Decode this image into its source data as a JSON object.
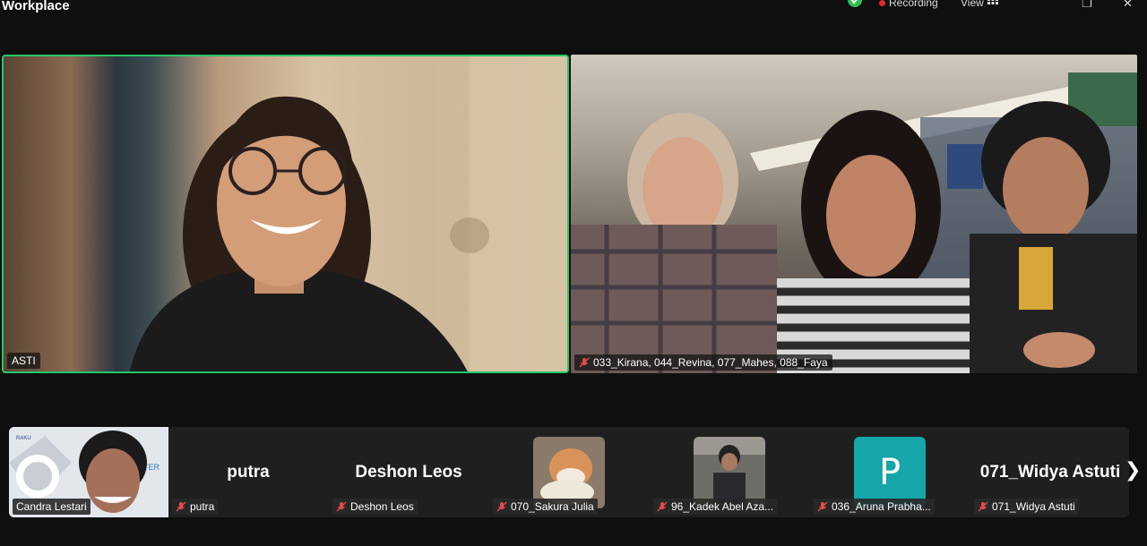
{
  "app": {
    "title": "Workplace"
  },
  "topbar": {
    "recording_label": "Recording",
    "view_label": "View",
    "colors": {
      "shield": "#2fbf4f",
      "recording": "#e02828"
    }
  },
  "speaker": {
    "name": "ASTI",
    "border_color": "#22c76a"
  },
  "group_tile": {
    "name": "033_Kirana, 044_Revina, 077_Mahes, 088_Faya",
    "muted": true
  },
  "filmstrip": {
    "participants": [
      {
        "name": "Candra Lestari",
        "type": "video",
        "muted": false
      },
      {
        "display": "putra",
        "name": "putra",
        "type": "name-only",
        "muted": true
      },
      {
        "display": "Deshon Leos",
        "name": "Deshon Leos",
        "type": "name-only",
        "muted": true
      },
      {
        "name": "070_Sakura Julia",
        "type": "photo",
        "muted": true
      },
      {
        "name": "96_Kadek Abel Aza...",
        "type": "photo",
        "muted": true
      },
      {
        "name": "036_Aruna Prabha...",
        "type": "avatar",
        "avatar_letter": "P",
        "muted": true
      },
      {
        "display": "071_Widya Astuti",
        "name": "071_Widya Astuti",
        "type": "name-only",
        "muted": true
      }
    ],
    "next_icon": "chevron-right-icon"
  }
}
